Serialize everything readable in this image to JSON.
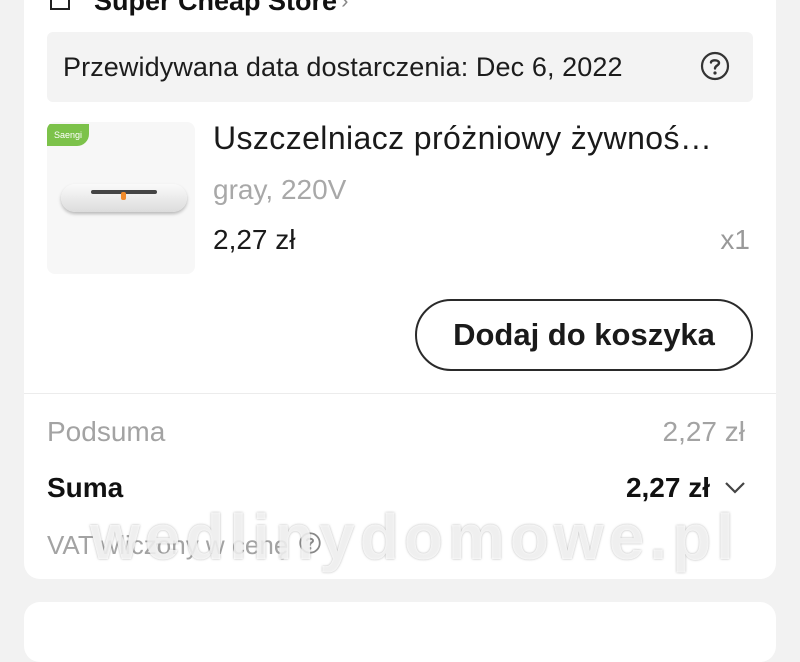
{
  "store": {
    "name": "Super Cheap Store",
    "icon": "store-icon",
    "chevron": "›"
  },
  "delivery": {
    "text": "Przewidywana data dostarczenia: Dec 6, 2022",
    "help_icon": "question-circle-icon"
  },
  "product": {
    "title": "Uszczelniacz próżniowy żywnoś…",
    "variant": "gray, 220V",
    "price": "2,27 zł",
    "quantity": "x1",
    "image_icon": "vacuum-sealer-image",
    "brand_badge": "Saengi"
  },
  "actions": {
    "add_to_cart": "Dodaj do koszyka"
  },
  "summary": {
    "subtotal_label": "Podsuma",
    "subtotal_value": "2,27 zł",
    "total_label": "Suma",
    "total_value": "2,27 zł",
    "vat_text": "VAT wliczony w cenę",
    "vat_help_icon": "question-circle-icon"
  },
  "watermark": "wedlinydomowe.pl",
  "colors": {
    "background": "#f2f2f2",
    "card": "#ffffff",
    "muted_text": "#a3a3a3",
    "badge": "#7cc24a"
  }
}
